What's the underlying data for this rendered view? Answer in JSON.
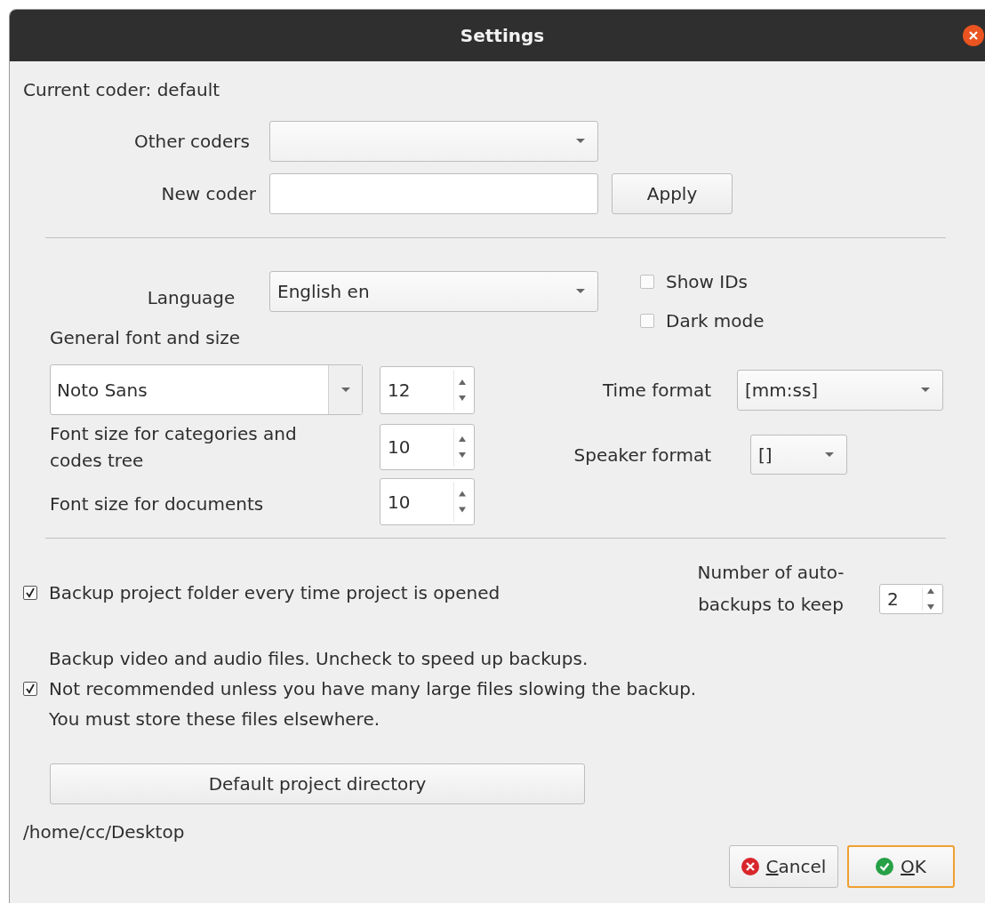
{
  "window": {
    "title": "Settings"
  },
  "current_coder": "Current coder: default",
  "other_coders": {
    "label": "Other coders"
  },
  "new_coder": {
    "label": "New coder",
    "button": "Apply"
  },
  "language": {
    "label": "Language",
    "value": "English en"
  },
  "options": [
    {
      "label": "Show IDs",
      "checked": false
    },
    {
      "label": "Dark mode",
      "checked": false
    }
  ],
  "general_font": {
    "label": "General font and size",
    "font": "Noto Sans",
    "size": "12"
  },
  "category_font": {
    "label": "Font size for categories and\ncodes tree",
    "size": "10"
  },
  "document_font": {
    "label": "Font size for documents",
    "size": "10"
  },
  "time_format": {
    "label": "Time format",
    "value": "[mm:ss]"
  },
  "speaker_format": {
    "label": "Speaker format",
    "value": "[]"
  },
  "backup_folder": {
    "label": "Backup project folder every time project is opened",
    "checked": true
  },
  "auto_backups": {
    "label": "Number of auto-\nbackups to keep",
    "value": "2"
  },
  "backup_media": {
    "label": "Backup video and audio files. Uncheck to speed up backups.\nNot recommended unless you have many large files slowing the backup.\nYou must store these files elsewhere.",
    "checked": true
  },
  "directory_button": "Default project directory",
  "directory_path": "/home/cc/Desktop",
  "buttons": [
    {
      "kind": "cancel",
      "label": "Cancel",
      "focused": false
    },
    {
      "kind": "ok",
      "label": "OK",
      "focused": true
    }
  ]
}
